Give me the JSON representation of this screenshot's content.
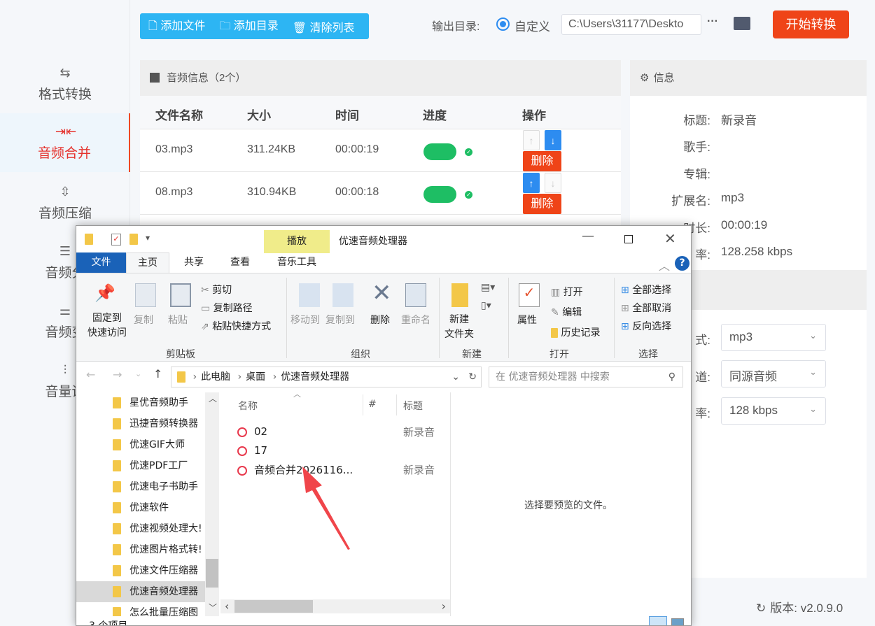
{
  "sidebar": {
    "items": [
      {
        "label": "格式转换",
        "icon": "format-convert-icon"
      },
      {
        "label": "音频合并",
        "icon": "merge-icon",
        "active": true
      },
      {
        "label": "音频压缩",
        "icon": "compress-icon"
      },
      {
        "label": "音频分",
        "icon": "split-icon"
      },
      {
        "label": "音频变",
        "icon": "speed-icon"
      },
      {
        "label": "音量调",
        "icon": "volume-icon"
      }
    ]
  },
  "toolbar": {
    "add_file": "添加文件",
    "add_dir": "添加目录",
    "clear_list": "清除列表",
    "output_label": "输出目录:",
    "radio_custom": "自定义",
    "output_path": "C:\\Users\\31177\\Deskto",
    "more": "···",
    "start": "开始转换"
  },
  "audio_panel": {
    "title": "音频信息（2个）",
    "columns": [
      "文件名称",
      "大小",
      "时间",
      "进度",
      "操作"
    ],
    "rows": [
      {
        "name": "03.mp3",
        "size": "311.24KB",
        "time": "00:00:19",
        "progress": 100,
        "delete": "删除"
      },
      {
        "name": "08.mp3",
        "size": "310.94KB",
        "time": "00:00:18",
        "progress": 100,
        "delete": "删除"
      }
    ]
  },
  "info_panel": {
    "title": "信息",
    "fields": [
      {
        "k": "标题:",
        "v": "新录音"
      },
      {
        "k": "歌手:",
        "v": ""
      },
      {
        "k": "专辑:",
        "v": ""
      },
      {
        "k": "扩展名:",
        "v": "mp3"
      },
      {
        "k": "时长:",
        "v": "00:00:19"
      },
      {
        "k": "率:",
        "v": "128.258 kbps"
      }
    ],
    "settings": [
      {
        "k": "式:",
        "v": "mp3"
      },
      {
        "k": "道:",
        "v": "同源音频"
      },
      {
        "k": "率:",
        "v": "128 kbps"
      }
    ],
    "version": "版本:  v2.0.9.0"
  },
  "explorer": {
    "title": "优速音频处理器",
    "context_tab": "播放",
    "tabs": [
      "文件",
      "主页",
      "共享",
      "查看",
      "音乐工具"
    ],
    "ribbon": {
      "pin": [
        "固定到",
        "快速访问"
      ],
      "copy": "复制",
      "paste": "粘贴",
      "cut": "剪切",
      "copy_path": "复制路径",
      "paste_shortcut": "粘贴快捷方式",
      "move_to": "移动到",
      "copy_to": "复制到",
      "delete": "删除",
      "rename": "重命名",
      "new_folder": [
        "新建",
        "文件夹"
      ],
      "properties": "属性",
      "open": "打开",
      "edit": "编辑",
      "history": "历史记录",
      "select_all": "全部选择",
      "select_none": "全部取消",
      "invert": "反向选择",
      "groups": [
        "剪贴板",
        "组织",
        "新建",
        "打开",
        "选择"
      ]
    },
    "breadcrumb": [
      "此电脑",
      "桌面",
      "优速音频处理器"
    ],
    "search_placeholder": "在 优速音频处理器 中搜索",
    "nav": [
      "星优音频助手",
      "迅捷音频转换器",
      "优速GIF大师",
      "优速PDF工厂",
      "优速电子书助手",
      "优速软件",
      "优速视频处理大!",
      "优速图片格式转!",
      "优速文件压缩器",
      "优速音频处理器",
      "怎么批量压缩图"
    ],
    "columns": [
      "名称",
      "#",
      "标题"
    ],
    "files": [
      {
        "name": "02",
        "title": "新录音"
      },
      {
        "name": "17",
        "title": ""
      },
      {
        "name": "音频合并2026116...",
        "title": "新录音"
      }
    ],
    "preview": "选择要预览的文件。",
    "status": "3 个项目"
  },
  "colors": {
    "accent": "#2db5f3",
    "start": "#ef4418",
    "progress": "#1ebe64",
    "active_nav": "#e5322d",
    "annotation_arrow": "#f0454a"
  }
}
